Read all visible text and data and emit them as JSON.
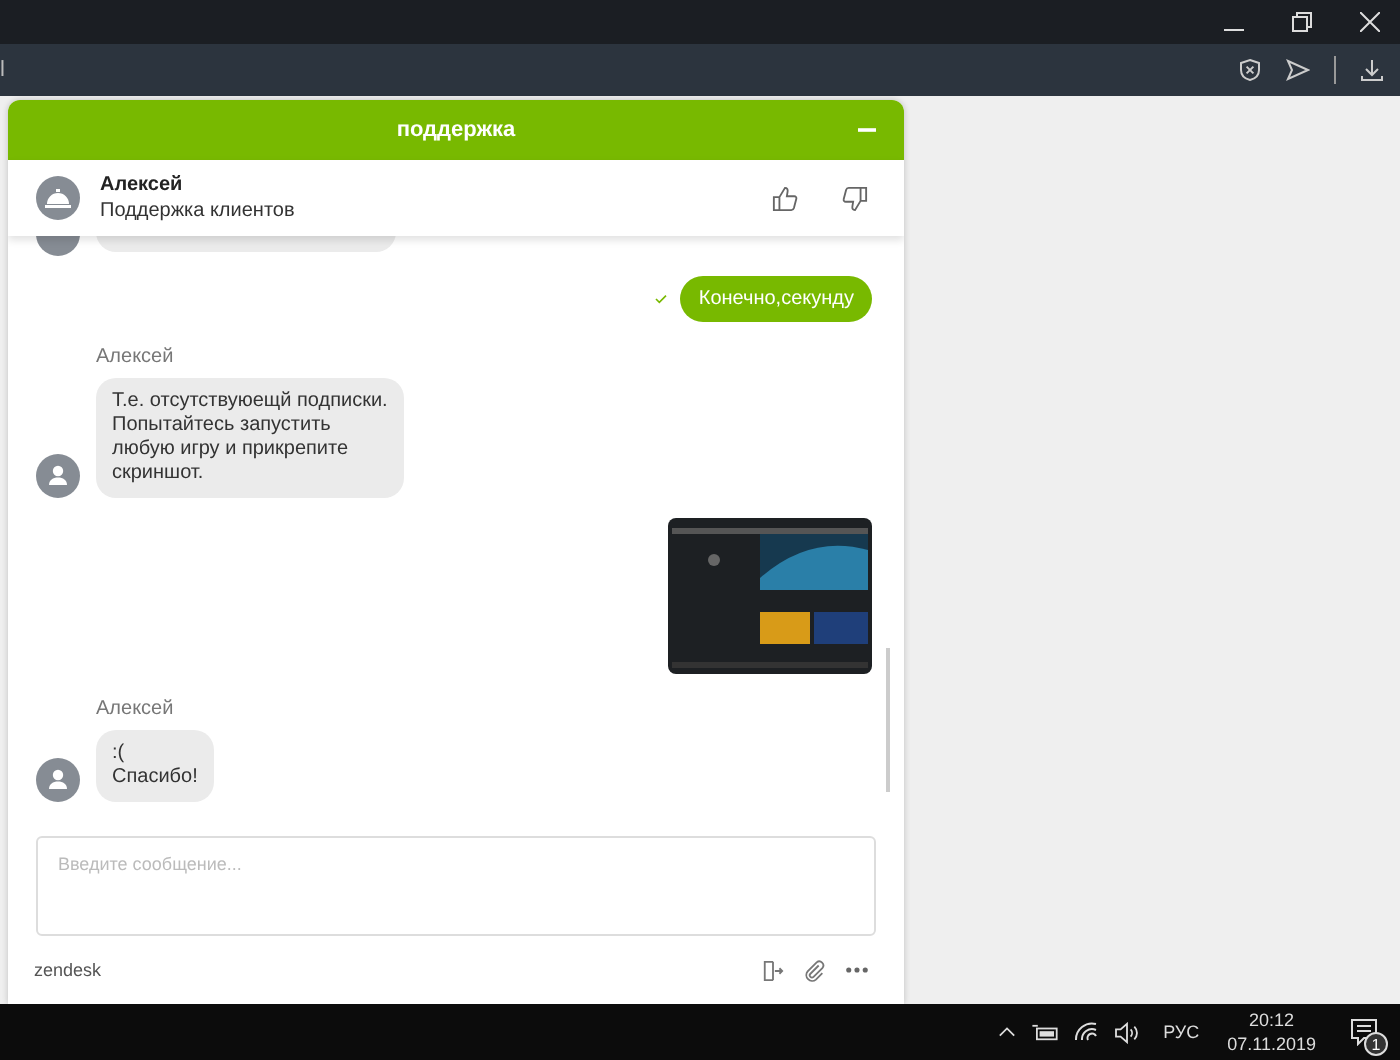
{
  "browser": {
    "address_fragment": "l"
  },
  "chat": {
    "title": "поддержка",
    "agent": {
      "name": "Алексей",
      "role": "Поддержка клиентов"
    },
    "messages": [
      {
        "kind": "partial"
      },
      {
        "kind": "sent",
        "text": "Конечно,секунду",
        "delivered": true
      },
      {
        "kind": "received",
        "sender": "Алексей",
        "text": "Т.е. отсутствуюещй подписки.\nПопытайтесь запустить\nлюбую игру и прикрепите\nскриншот."
      },
      {
        "kind": "image"
      },
      {
        "kind": "received",
        "sender": "Алексей",
        "text": ":(\nСпасибо!"
      }
    ],
    "input": {
      "placeholder": "Введите сообщение..."
    },
    "footer": {
      "brand": "zendesk"
    }
  },
  "taskbar": {
    "language": "РУС",
    "time": "20:12",
    "date": "07.11.2019",
    "notifications": "1"
  }
}
